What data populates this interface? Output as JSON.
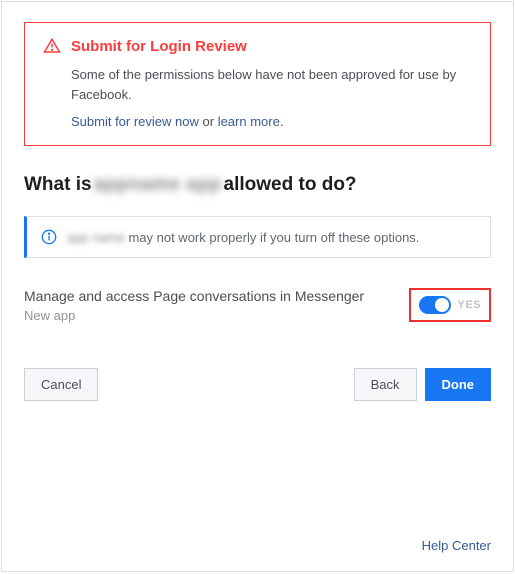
{
  "alert": {
    "title": "Submit for Login Review",
    "body": "Some of the permissions below have not been approved for use by Facebook.",
    "submit_link": "Submit for review now",
    "or": " or ",
    "learn_link": "learn more",
    "period": "."
  },
  "heading": {
    "prefix": "What is ",
    "app_name": "appname app",
    "suffix": "allowed to do?"
  },
  "info": {
    "app_name": "app name",
    "text": "may not work properly if you turn off these options."
  },
  "permission": {
    "title": "Manage and access Page conversations in Messenger",
    "subtitle": "New app",
    "toggle_label": "YES"
  },
  "buttons": {
    "cancel": "Cancel",
    "back": "Back",
    "done": "Done"
  },
  "footer": {
    "help": "Help Center"
  }
}
